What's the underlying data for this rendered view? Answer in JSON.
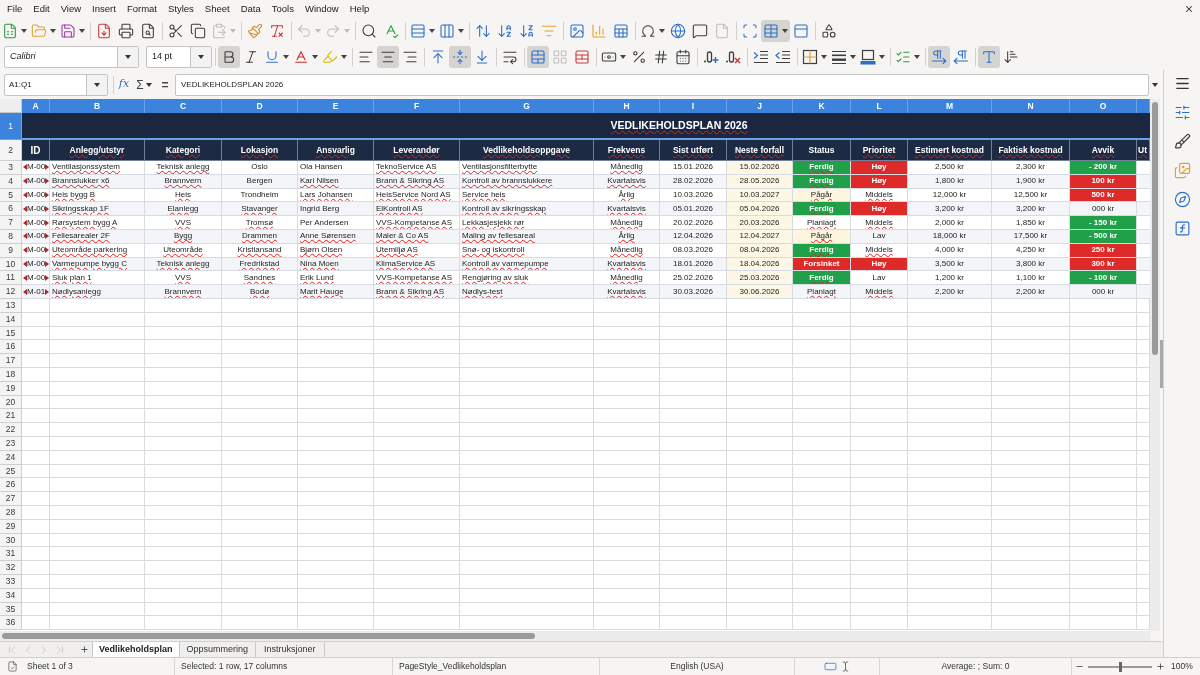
{
  "menu_bar": [
    "File",
    "Edit",
    "View",
    "Insert",
    "Format",
    "Styles",
    "Sheet",
    "Data",
    "Tools",
    "Window",
    "Help"
  ],
  "standard_toolbar": {
    "groups": [
      [
        {
          "kind": "new",
          "on": false,
          "disabled": false
        },
        {
          "kind": "open",
          "on": false,
          "disabled": false
        },
        {
          "kind": "save",
          "on": false,
          "disabled": false
        }
      ],
      [
        {
          "kind": "export_pdf",
          "on": false,
          "disabled": false
        },
        {
          "kind": "print",
          "on": false,
          "disabled": false
        },
        {
          "kind": "print_preview",
          "on": false,
          "disabled": false
        }
      ],
      [
        {
          "kind": "cut",
          "on": false,
          "disabled": false
        },
        {
          "kind": "copy",
          "on": false,
          "disabled": false
        },
        {
          "kind": "paste",
          "on": false,
          "disabled": true
        }
      ],
      [
        {
          "kind": "clone_formatting",
          "on": false,
          "disabled": false
        },
        {
          "kind": "clear_formatting",
          "on": false,
          "disabled": false
        }
      ],
      [
        {
          "kind": "undo",
          "on": false,
          "disabled": true
        },
        {
          "kind": "redo",
          "on": false,
          "disabled": true
        }
      ],
      [
        {
          "kind": "find_replace",
          "on": false,
          "disabled": false
        },
        {
          "kind": "spelling",
          "on": false,
          "disabled": false
        }
      ],
      [
        {
          "kind": "row",
          "on": false,
          "disabled": false
        },
        {
          "kind": "column",
          "on": false,
          "disabled": false
        }
      ],
      [
        {
          "kind": "sort",
          "on": false,
          "disabled": false
        },
        {
          "kind": "sort_ascending",
          "on": false,
          "disabled": false
        },
        {
          "kind": "sort_descending",
          "on": false,
          "disabled": false
        },
        {
          "kind": "autofilter",
          "on": false,
          "disabled": false
        }
      ],
      [
        {
          "kind": "image",
          "on": false,
          "disabled": false
        },
        {
          "kind": "chart",
          "on": false,
          "disabled": false
        },
        {
          "kind": "pivot_table",
          "on": false,
          "disabled": false
        }
      ],
      [
        {
          "kind": "special_character",
          "on": false,
          "disabled": false
        },
        {
          "kind": "hyperlink",
          "on": false,
          "disabled": false
        },
        {
          "kind": "comment",
          "on": false,
          "disabled": false
        },
        {
          "kind": "header_footer",
          "on": false,
          "disabled": true
        }
      ],
      [
        {
          "kind": "print_area",
          "on": false,
          "disabled": false
        },
        {
          "kind": "freeze",
          "on": true,
          "disabled": false
        },
        {
          "kind": "split_window",
          "on": false,
          "disabled": false
        }
      ],
      [
        {
          "kind": "draw_functions",
          "on": false,
          "disabled": false
        }
      ]
    ]
  },
  "formatting_toolbar": {
    "font_name": "Calibri",
    "font_size": "14 pt",
    "groups": [
      [
        {
          "kind": "bold",
          "on": true,
          "disabled": false
        },
        {
          "kind": "italic",
          "on": false,
          "disabled": false
        },
        {
          "kind": "underline",
          "on": false,
          "disabled": false
        },
        {
          "kind": "font_color",
          "on": false,
          "disabled": false
        },
        {
          "kind": "highlight",
          "on": false,
          "disabled": false
        }
      ],
      [
        {
          "kind": "align_left",
          "on": false,
          "disabled": false
        },
        {
          "kind": "align_center",
          "on": true,
          "disabled": false
        },
        {
          "kind": "align_right",
          "on": false,
          "disabled": false
        }
      ],
      [
        {
          "kind": "align_top",
          "on": false,
          "disabled": false
        },
        {
          "kind": "align_middle",
          "on": true,
          "disabled": false
        },
        {
          "kind": "align_bottom",
          "on": false,
          "disabled": false
        }
      ],
      [
        {
          "kind": "wrap_text",
          "on": false,
          "disabled": false
        }
      ],
      [
        {
          "kind": "merge_center",
          "on": true,
          "disabled": false
        },
        {
          "kind": "merge_cells",
          "on": false,
          "disabled": true
        },
        {
          "kind": "unmerge_cells",
          "on": false,
          "disabled": false
        }
      ],
      [
        {
          "kind": "currency",
          "on": false,
          "disabled": false
        },
        {
          "kind": "percent",
          "on": false,
          "disabled": false
        },
        {
          "kind": "number",
          "on": false,
          "disabled": false
        },
        {
          "kind": "date",
          "on": false,
          "disabled": false
        }
      ],
      [
        {
          "kind": "add_decimal",
          "on": false,
          "disabled": false
        },
        {
          "kind": "delete_decimal",
          "on": false,
          "disabled": false
        }
      ],
      [
        {
          "kind": "indent_increase",
          "on": false,
          "disabled": false
        },
        {
          "kind": "indent_decrease",
          "on": false,
          "disabled": false
        }
      ],
      [
        {
          "kind": "borders",
          "on": false,
          "disabled": false
        },
        {
          "kind": "border_style",
          "on": false,
          "disabled": false
        },
        {
          "kind": "border_color",
          "on": false,
          "disabled": false
        }
      ],
      [
        {
          "kind": "conditional",
          "on": false,
          "disabled": false
        }
      ],
      [
        {
          "kind": "left_to_right",
          "on": true,
          "disabled": false
        },
        {
          "kind": "right_to_left",
          "on": false,
          "disabled": false
        }
      ],
      [
        {
          "kind": "horizontal_text",
          "on": true,
          "disabled": false
        },
        {
          "kind": "vertical_text",
          "on": false,
          "disabled": false
        }
      ]
    ]
  },
  "formula_bar": {
    "name_box": "A1:Q1",
    "function_wizard": "fx",
    "sum": "Σ",
    "equals": "=",
    "content": "VEDLIKEHOLDSPLAN 2026"
  },
  "sheet": {
    "column_headers": [
      {
        "label": "A",
        "selected": true
      },
      {
        "label": "B",
        "selected": true
      },
      {
        "label": "C",
        "selected": true
      },
      {
        "label": "D",
        "selected": true
      },
      {
        "label": "E",
        "selected": true
      },
      {
        "label": "F",
        "selected": true
      },
      {
        "label": "G",
        "selected": true
      },
      {
        "label": "H",
        "selected": true
      },
      {
        "label": "I",
        "selected": true
      },
      {
        "label": "J",
        "selected": true
      },
      {
        "label": "K",
        "selected": true
      },
      {
        "label": "L",
        "selected": true
      },
      {
        "label": "M",
        "selected": true
      },
      {
        "label": "N",
        "selected": true
      },
      {
        "label": "O",
        "selected": true
      },
      {
        "selected": true
      }
    ],
    "row_headers": [
      {
        "label": "1",
        "selected": true
      },
      {
        "label": "2",
        "selected": false
      },
      {
        "label": "3",
        "selected": false
      },
      {
        "label": "4",
        "selected": false
      },
      {
        "label": "5",
        "selected": false
      },
      {
        "label": "6",
        "selected": false
      },
      {
        "label": "7",
        "selected": false
      },
      {
        "label": "8",
        "selected": false
      },
      {
        "label": "9",
        "selected": false
      },
      {
        "label": "10",
        "selected": false
      },
      {
        "label": "11",
        "selected": false
      },
      {
        "label": "12",
        "selected": false
      },
      {
        "label": "13",
        "selected": false
      },
      {
        "label": "14",
        "selected": false
      },
      {
        "label": "15",
        "selected": false
      },
      {
        "label": "16",
        "selected": false
      },
      {
        "label": "17",
        "selected": false
      },
      {
        "label": "18",
        "selected": false
      },
      {
        "label": "19",
        "selected": false
      },
      {
        "label": "20",
        "selected": false
      },
      {
        "label": "21",
        "selected": false
      },
      {
        "label": "22",
        "selected": false
      },
      {
        "label": "23",
        "selected": false
      },
      {
        "label": "24",
        "selected": false
      },
      {
        "label": "25",
        "selected": false
      },
      {
        "label": "26",
        "selected": false
      },
      {
        "label": "27",
        "selected": false
      },
      {
        "label": "28",
        "selected": false
      },
      {
        "label": "29",
        "selected": false
      },
      {
        "label": "30",
        "selected": false
      },
      {
        "label": "31",
        "selected": false
      },
      {
        "label": "32",
        "selected": false
      },
      {
        "label": "33",
        "selected": false
      },
      {
        "label": "34",
        "selected": false
      },
      {
        "label": "35",
        "selected": false
      },
      {
        "label": "36",
        "selected": false
      }
    ],
    "title": {
      "text": "VEDLIKEHOLDSPLAN 2026",
      "misspelled": true
    },
    "header_row": [
      {
        "text": "ID",
        "misspelled": false
      },
      {
        "text": "Anlegg/utstyr",
        "misspelled": true
      },
      {
        "text": "Kategori",
        "misspelled": true
      },
      {
        "text": "Lokasjon",
        "misspelled": true
      },
      {
        "text": "Ansvarlig",
        "misspelled": true
      },
      {
        "text": "Leverandør",
        "misspelled": true
      },
      {
        "text": "Vedlikeholdsoppgave",
        "misspelled": true
      },
      {
        "text": "Frekvens",
        "misspelled": true
      },
      {
        "text": "Sist utført",
        "misspelled": true
      },
      {
        "text": "Neste forfall",
        "misspelled": true
      },
      {
        "text": "Status",
        "misspelled": false
      },
      {
        "text": "Prioritet",
        "misspelled": true
      },
      {
        "text": "Estimert kostnad",
        "misspelled": true
      },
      {
        "text": "Faktisk kostnad",
        "misspelled": true
      },
      {
        "text": "Avvik",
        "misspelled": true
      },
      {
        "text": "Ut",
        "misspelled": true
      }
    ],
    "rows": [
      {
        "id": {
          "text": "M-00",
          "clipped": true
        },
        "cells": [
          {
            "text": "Ventilasjonssystem",
            "misspelled": true
          },
          {
            "text": "Teknisk anlegg",
            "misspelled": true
          },
          {
            "text": "Oslo",
            "misspelled": false
          },
          {
            "text": "Ola Hansen",
            "misspelled": false
          },
          {
            "text": "TeknoService AS",
            "misspelled": true
          },
          {
            "text": "Ventilasjonsfilterbytte",
            "misspelled": true
          },
          {
            "text": "Månedlig",
            "misspelled": true
          },
          {
            "text": "15.01.2026",
            "misspelled": false
          },
          {
            "text": "15.02.2026",
            "misspelled": false
          },
          {
            "text": "Ferdig",
            "misspelled": true,
            "color": "#21a04a"
          },
          {
            "text": "Høy",
            "color": "#df2a2a"
          },
          {
            "text": "2,500 kr",
            "misspelled": false
          },
          {
            "text": "2,300 kr",
            "misspelled": false
          },
          {
            "text": "- 200 kr",
            "misspelled": false,
            "color": "#21a04a"
          }
        ]
      },
      {
        "id": {
          "text": "M-00",
          "clipped": true
        },
        "cells": [
          {
            "text": "Brannslukker x6",
            "misspelled": true
          },
          {
            "text": "Brannvern",
            "misspelled": true
          },
          {
            "text": "Bergen",
            "misspelled": false
          },
          {
            "text": "Kari Nilsen",
            "misspelled": true
          },
          {
            "text": "Brann & Sikring AS",
            "misspelled": true
          },
          {
            "text": "Kontroll av brannslukkere",
            "misspelled": true
          },
          {
            "text": "Kvartalsvis",
            "misspelled": true
          },
          {
            "text": "28.02.2026",
            "misspelled": false
          },
          {
            "text": "28.05.2026",
            "misspelled": false
          },
          {
            "text": "Ferdig",
            "misspelled": true,
            "color": "#21a04a"
          },
          {
            "text": "Høy",
            "color": "#df2a2a"
          },
          {
            "text": "1,800 kr",
            "misspelled": false
          },
          {
            "text": "1,900 kr",
            "misspelled": false
          },
          {
            "text": "100 kr",
            "color": "#df2a2a"
          }
        ]
      },
      {
        "id": {
          "text": "M-00",
          "clipped": true
        },
        "cells": [
          {
            "text": "Heis bygg B",
            "misspelled": true
          },
          {
            "text": "Heis",
            "misspelled": true
          },
          {
            "text": "Trondheim",
            "misspelled": false
          },
          {
            "text": "Lars Johansen",
            "misspelled": true
          },
          {
            "text": "HeisService Nord AS",
            "misspelled": true
          },
          {
            "text": "Service heis",
            "misspelled": true
          },
          {
            "text": "Årlig",
            "misspelled": true
          },
          {
            "text": "10.03.2026",
            "misspelled": false
          },
          {
            "text": "10.03.2027",
            "misspelled": false
          },
          {
            "text": "Pågår",
            "misspelled": true,
            "color": "#fdf6df"
          },
          {
            "text": "Middels",
            "misspelled": true
          },
          {
            "text": "12,000 kr",
            "misspelled": false
          },
          {
            "text": "12,500 kr",
            "misspelled": false
          },
          {
            "text": "500 kr",
            "color": "#df2a2a"
          }
        ]
      },
      {
        "id": {
          "text": "M-00",
          "clipped": true
        },
        "cells": [
          {
            "text": "Sikringsskap 1F",
            "misspelled": true
          },
          {
            "text": "Elanlegg",
            "misspelled": true
          },
          {
            "text": "Stavanger",
            "misspelled": true
          },
          {
            "text": "Ingrid Berg",
            "misspelled": false
          },
          {
            "text": "ElKontroll AS",
            "misspelled": true
          },
          {
            "text": "Kontroll av sikringsskap",
            "misspelled": true
          },
          {
            "text": "Kvartalsvis",
            "misspelled": true
          },
          {
            "text": "05.01.2026",
            "misspelled": false
          },
          {
            "text": "05.04.2026",
            "misspelled": false
          },
          {
            "text": "Ferdig",
            "misspelled": true,
            "color": "#21a04a"
          },
          {
            "text": "Høy",
            "color": "#df2a2a"
          },
          {
            "text": "3,200 kr",
            "misspelled": false
          },
          {
            "text": "3,200 kr",
            "misspelled": false
          },
          {
            "text": "000 kr",
            "misspelled": false
          }
        ]
      },
      {
        "id": {
          "text": "M-00",
          "clipped": true
        },
        "cells": [
          {
            "text": "Rørsystem bygg A",
            "misspelled": true
          },
          {
            "text": "VVS",
            "misspelled": true
          },
          {
            "text": "Tromsø",
            "misspelled": true
          },
          {
            "text": "Per Andersen",
            "misspelled": false
          },
          {
            "text": "VVS-Kompetanse AS",
            "misspelled": true
          },
          {
            "text": "Lekkasjesjekk rør",
            "misspelled": true
          },
          {
            "text": "Månedlig",
            "misspelled": true
          },
          {
            "text": "20.02.2026",
            "misspelled": false
          },
          {
            "text": "20.03.2026",
            "misspelled": false
          },
          {
            "text": "Planlagt",
            "misspelled": true
          },
          {
            "text": "Middels",
            "misspelled": true
          },
          {
            "text": "2,000 kr",
            "misspelled": false
          },
          {
            "text": "1,850 kr",
            "misspelled": false
          },
          {
            "text": "- 150 kr",
            "misspelled": false,
            "color": "#21a04a"
          }
        ]
      },
      {
        "id": {
          "text": "M-00",
          "clipped": true
        },
        "cells": [
          {
            "text": "Fellesarealer 2F",
            "misspelled": true
          },
          {
            "text": "Bygg",
            "misspelled": true
          },
          {
            "text": "Drammen",
            "misspelled": true
          },
          {
            "text": "Anne Sørensen",
            "misspelled": true
          },
          {
            "text": "Maler & Co AS",
            "misspelled": true
          },
          {
            "text": "Maling av fellesareal",
            "misspelled": true
          },
          {
            "text": "Årlig",
            "misspelled": true
          },
          {
            "text": "12.04.2026",
            "misspelled": false
          },
          {
            "text": "12.04.2027",
            "misspelled": false
          },
          {
            "text": "Pågår",
            "misspelled": true,
            "color": "#fdf6df"
          },
          {
            "text": "Lav",
            "misspelled": false
          },
          {
            "text": "18,000 kr",
            "misspelled": false
          },
          {
            "text": "17,500 kr",
            "misspelled": false
          },
          {
            "text": "- 500 kr",
            "misspelled": false,
            "color": "#21a04a"
          }
        ]
      },
      {
        "id": {
          "text": "M-00",
          "clipped": true
        },
        "cells": [
          {
            "text": "Uteområde parkering",
            "misspelled": true
          },
          {
            "text": "Uteområde",
            "misspelled": true
          },
          {
            "text": "Kristiansand",
            "misspelled": true
          },
          {
            "text": "Bjørn Olsen",
            "misspelled": true
          },
          {
            "text": "Utemiljø AS",
            "misspelled": true
          },
          {
            "text": "Snø- og iskontroll",
            "misspelled": true
          },
          {
            "text": "Månedlig",
            "misspelled": true
          },
          {
            "text": "08.03.2026",
            "misspelled": false
          },
          {
            "text": "08.04.2026",
            "misspelled": false
          },
          {
            "text": "Ferdig",
            "misspelled": true,
            "color": "#21a04a"
          },
          {
            "text": "Middels",
            "misspelled": true
          },
          {
            "text": "4,000 kr",
            "misspelled": false
          },
          {
            "text": "4,250 kr",
            "misspelled": false
          },
          {
            "text": "250 kr",
            "color": "#df2a2a"
          }
        ]
      },
      {
        "id": {
          "text": "M-00",
          "clipped": true
        },
        "cells": [
          {
            "text": "Varmepumpe bygg C",
            "misspelled": true
          },
          {
            "text": "Teknisk anlegg",
            "misspelled": true
          },
          {
            "text": "Fredrikstad",
            "misspelled": true
          },
          {
            "text": "Nina Moen",
            "misspelled": true
          },
          {
            "text": "KlimaService AS",
            "misspelled": true
          },
          {
            "text": "Kontroll av varmepumpe",
            "misspelled": true
          },
          {
            "text": "Kvartalsvis",
            "misspelled": true
          },
          {
            "text": "18.01.2026",
            "misspelled": false
          },
          {
            "text": "18.04.2026",
            "misspelled": false
          },
          {
            "text": "Forsinket",
            "color": "#df2a2a"
          },
          {
            "text": "Høy",
            "color": "#df2a2a"
          },
          {
            "text": "3,500 kr",
            "misspelled": false
          },
          {
            "text": "3,800 kr",
            "misspelled": false
          },
          {
            "text": "300 kr",
            "color": "#df2a2a"
          }
        ]
      },
      {
        "id": {
          "text": "M-00",
          "clipped": true
        },
        "cells": [
          {
            "text": "Sluk plan 1",
            "misspelled": true
          },
          {
            "text": "VVS",
            "misspelled": true
          },
          {
            "text": "Sandnes",
            "misspelled": true
          },
          {
            "text": "Erik Lund",
            "misspelled": true
          },
          {
            "text": "VVS-Kompetanse AS",
            "misspelled": true
          },
          {
            "text": "Rengjøring av sluk",
            "misspelled": true
          },
          {
            "text": "Månedlig",
            "misspelled": true
          },
          {
            "text": "25.02.2026",
            "misspelled": false
          },
          {
            "text": "25.03.2026",
            "misspelled": false
          },
          {
            "text": "Ferdig",
            "misspelled": true,
            "color": "#21a04a"
          },
          {
            "text": "Lav",
            "misspelled": false
          },
          {
            "text": "1,200 kr",
            "misspelled": false
          },
          {
            "text": "1,100 kr",
            "misspelled": false
          },
          {
            "text": "- 100 kr",
            "misspelled": false,
            "color": "#21a04a"
          }
        ]
      },
      {
        "id": {
          "text": "M-01",
          "clipped": true
        },
        "cells": [
          {
            "text": "Nødlysanlegg",
            "misspelled": true
          },
          {
            "text": "Brannvern",
            "misspelled": true
          },
          {
            "text": "Bodø",
            "misspelled": true
          },
          {
            "text": "Marit Hauge",
            "misspelled": true
          },
          {
            "text": "Brann & Sikring AS",
            "misspelled": true
          },
          {
            "text": "Nødlys-test",
            "misspelled": true
          },
          {
            "text": "Kvartalsvis",
            "misspelled": true
          },
          {
            "text": "30.03.2026",
            "misspelled": false
          },
          {
            "text": "30.06.2026",
            "misspelled": false
          },
          {
            "text": "Planlagt",
            "misspelled": true
          },
          {
            "text": "Middels",
            "misspelled": true
          },
          {
            "text": "2,200 kr",
            "misspelled": false
          },
          {
            "text": "2,200 kr",
            "misspelled": false
          },
          {
            "text": "000 kr",
            "misspelled": false
          }
        ]
      }
    ]
  },
  "sheet_navigation": [
    {
      "kind": "first",
      "disabled": true
    },
    {
      "kind": "previous",
      "disabled": true
    },
    {
      "kind": "next",
      "disabled": true
    },
    {
      "kind": "last",
      "disabled": true
    }
  ],
  "sheet_tabs": [
    {
      "label": "Vedlikeholdsplan",
      "selected": true
    },
    {
      "label": "Oppsummering",
      "selected": false
    },
    {
      "label": "Instruksjoner",
      "selected": false
    }
  ],
  "status_bar": {
    "sheet": "Sheet 1 of 3",
    "selection": "Selected: 1 row, 17 columns",
    "page_style": "PageStyle_Vedlikeholdsplan",
    "language": "English (USA)",
    "summary": "Average: ; Sum: 0",
    "zoom": {
      "level": 0.5,
      "reading": "100%"
    }
  }
}
